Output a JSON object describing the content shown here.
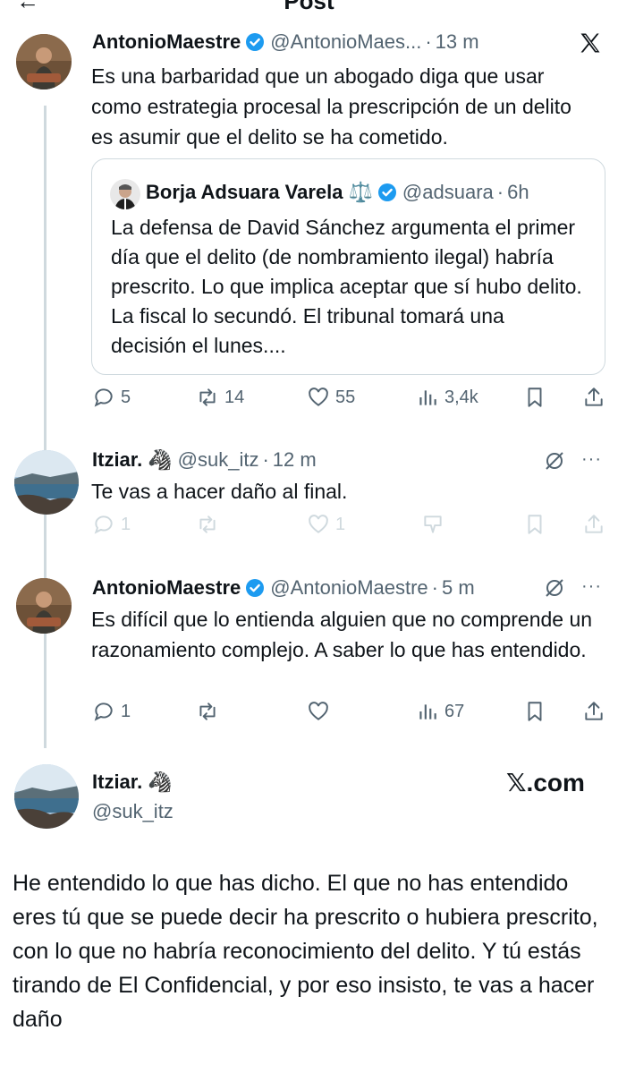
{
  "header": {
    "title": "Post"
  },
  "colors": {
    "accent": "#1d9bf0",
    "muted": "#536471",
    "line": "#cfd9de",
    "text": "#0f1419"
  },
  "post1": {
    "name": "AntonioMaestre",
    "handle": "@AntonioMaes...",
    "time": "13 m",
    "text": "Es una barbaridad que un abogado diga que usar como estrategia procesal la prescripción de un delito es asumir que el delito se ha cometido.",
    "quote": {
      "name": "Borja Adsuara Varela",
      "emoji": "⚖️",
      "handle": "@adsuara",
      "time": "6h",
      "text": "La defensa de David Sánchez argumenta el primer día que el delito (de nombramiento ilegal) habría prescrito. Lo que implica aceptar que sí hubo delito. La fiscal lo secundó. El tribunal tomará una decisión el lunes...."
    },
    "stats": {
      "replies": "5",
      "reposts": "14",
      "likes": "55",
      "views": "3,4k"
    }
  },
  "post2": {
    "name": "Itziar.",
    "emoji": "🦓",
    "handle": "@suk_itz",
    "time": "12 m",
    "text": "Te vas a hacer daño al final.",
    "stats": {
      "replies": "1",
      "likes": "1"
    }
  },
  "post3": {
    "name": "AntonioMaestre",
    "handle": "@AntonioMaestre",
    "time": "5 m",
    "text": "Es difícil que lo entienda alguien que no comprende un razonamiento complejo. A saber lo que has entendido.",
    "stats": {
      "replies": "1",
      "views": "67"
    }
  },
  "post4": {
    "name": "Itziar.",
    "emoji": "🦓",
    "handle": "@suk_itz",
    "brand": "𝕏.com",
    "text": "He entendido lo que has dicho. El que no has entendido eres tú que se puede decir ha prescrito o hubiera prescrito, con lo que no habría reconocimiento del delito. Y tú estás tirando de El Confidencial, y por eso insisto, te vas a hacer daño"
  },
  "icons": [
    "x-logo-icon",
    "verified-badge-icon",
    "reply-icon",
    "repost-icon",
    "like-icon",
    "views-icon",
    "bookmark-icon",
    "share-icon",
    "grok-icon",
    "more-icon"
  ]
}
